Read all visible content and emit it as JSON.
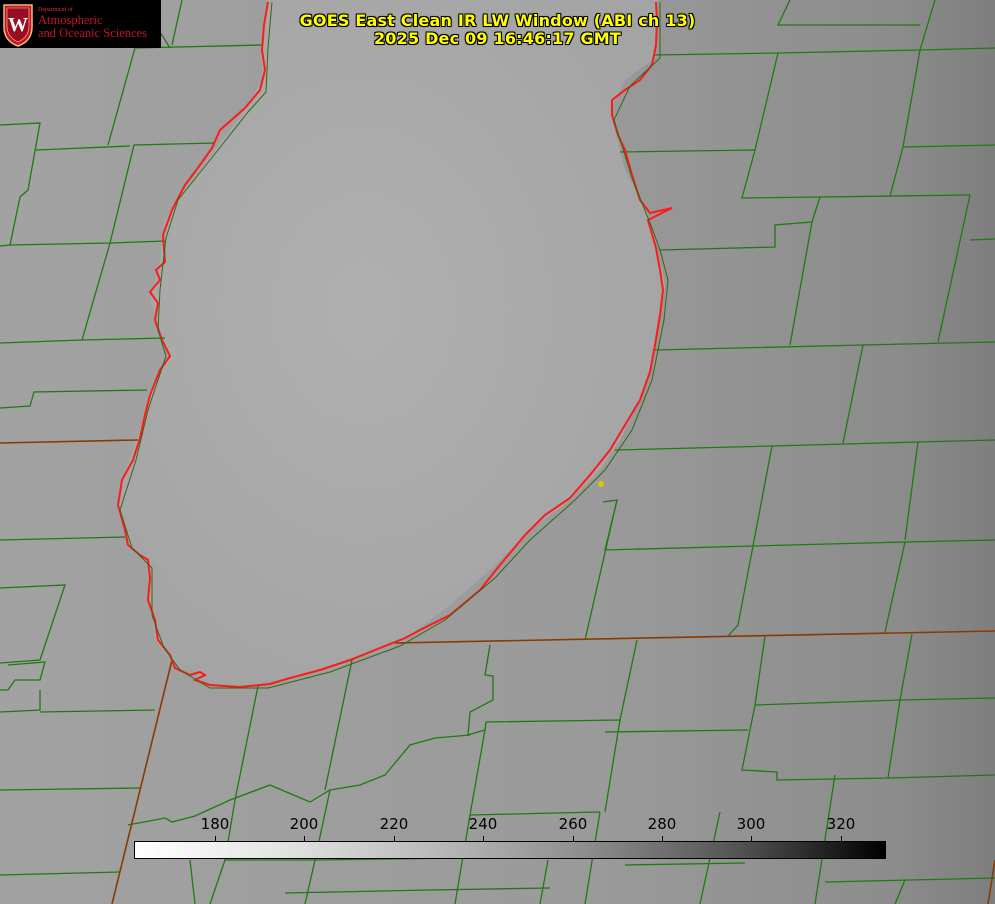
{
  "title_line1": "GOES East Clean IR LW Window (ABI ch 13)",
  "title_line2": "2025 Dec 09 16:46:17 GMT",
  "logo": {
    "dept": "Department of",
    "line1": "Atmospheric",
    "line2": "and Oceanic Sciences",
    "badge_letter": "W",
    "icon": "uw-crest-icon"
  },
  "colorbar": {
    "ticks": [
      "180",
      "200",
      "220",
      "240",
      "260",
      "280",
      "300",
      "320"
    ],
    "gradient": "white-to-black"
  },
  "colors": {
    "county_lines": "#1f7a12",
    "state_lines": "#8a3a00",
    "lake_shoreline": "#ff1a1a",
    "title_text": "#ffff00",
    "marker": "#d8c800"
  }
}
